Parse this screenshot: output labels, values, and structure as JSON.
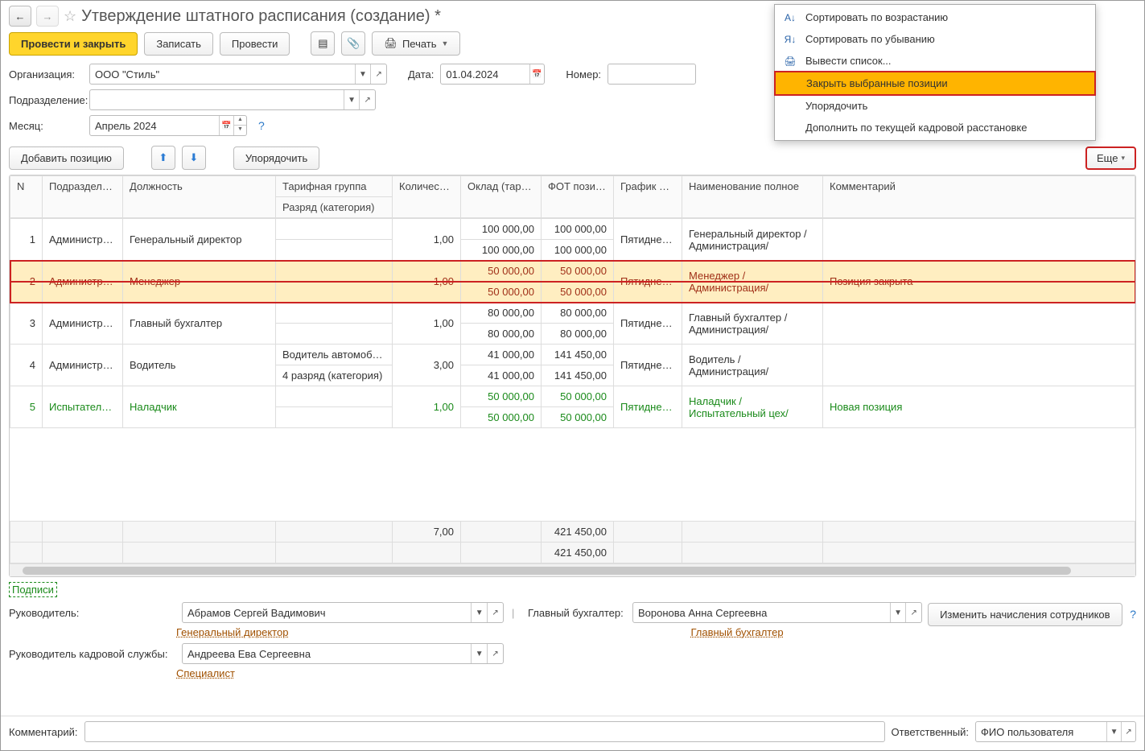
{
  "title": "Утверждение штатного расписания (создание) *",
  "toolbar": {
    "post_close": "Провести и закрыть",
    "save": "Записать",
    "post": "Провести",
    "print": "Печать"
  },
  "form": {
    "org_label": "Организация:",
    "org_value": "ООО \"Стиль\"",
    "dept_label": "Подразделение:",
    "dept_value": "",
    "month_label": "Месяц:",
    "month_value": "Апрель 2024",
    "date_label": "Дата:",
    "date_value": "01.04.2024",
    "number_label": "Номер:",
    "number_value": ""
  },
  "toolbar2": {
    "add_position": "Добавить позицию",
    "reorder": "Упорядочить",
    "more": "Еще"
  },
  "columns": {
    "n": "N",
    "dept": "Подразделение",
    "position": "Должность",
    "tariff_group": "Тарифная группа",
    "rank": "Разряд (категория)",
    "rates": "Количество ставок",
    "salary": "Оклад (тариф), ...",
    "fot": "ФОТ позиции, ...",
    "schedule": "График работы",
    "fullname": "Наименование полное",
    "comment": "Комментарий"
  },
  "rows": [
    {
      "n": "1",
      "dept": "Администраци",
      "pos": "Генеральный директор",
      "tg": "",
      "rank": "",
      "rates": "1,00",
      "salary": "100 000,00",
      "salary2": "100 000,00",
      "fot": "100 000,00",
      "fot2": "100 000,00",
      "sched": "Пятидневка",
      "full": "Генеральный директор /Администрация/",
      "comment": "",
      "cls": ""
    },
    {
      "n": "2",
      "dept": "Администраци",
      "pos": "Менеджер",
      "tg": "",
      "rank": "",
      "rates": "1,00",
      "salary": "50 000,00",
      "salary2": "50 000,00",
      "fot": "50 000,00",
      "fot2": "50 000,00",
      "sched": "Пятидневка",
      "full": "Менеджер /Администрация/",
      "comment": "Позиция закрыта",
      "cls": "row-closed"
    },
    {
      "n": "3",
      "dept": "Администраци",
      "pos": "Главный бухгалтер",
      "tg": "",
      "rank": "",
      "rates": "1,00",
      "salary": "80 000,00",
      "salary2": "80 000,00",
      "fot": "80 000,00",
      "fot2": "80 000,00",
      "sched": "Пятидневка",
      "full": "Главный бухгалтер /Администрация/",
      "comment": "",
      "cls": ""
    },
    {
      "n": "4",
      "dept": "Администраци",
      "pos": "Водитель",
      "tg": "Водитель автомоби...",
      "rank": "4 разряд (категория)",
      "rates": "3,00",
      "salary": "41 000,00",
      "salary2": "41 000,00",
      "fot": "141 450,00",
      "fot2": "141 450,00",
      "sched": "Пятидневка",
      "full": "Водитель /Администрация/",
      "comment": "",
      "cls": ""
    },
    {
      "n": "5",
      "dept": "Испытательны цех",
      "pos": "Наладчик",
      "tg": "",
      "rank": "",
      "rates": "1,00",
      "salary": "50 000,00",
      "salary2": "50 000,00",
      "fot": "50 000,00",
      "fot2": "50 000,00",
      "sched": "Пятидневка",
      "full": "Наладчик /Испытательный цех/",
      "comment": "Новая позиция",
      "cls": "row-new"
    }
  ],
  "totals": {
    "rates": "7,00",
    "fot1": "421 450,00",
    "fot2": "421 450,00"
  },
  "footer": {
    "signatures": "Подписи",
    "manager_label": "Руководитель:",
    "manager_value": "Абрамов Сергей Вадимович",
    "manager_role": "Генеральный директор",
    "accountant_label": "Главный бухгалтер:",
    "accountant_value": "Воронова Анна Сергеевна",
    "accountant_role": "Главный бухгалтер",
    "hr_label": "Руководитель кадровой службы:",
    "hr_value": "Андреева Ева Сергеевна",
    "hr_role": "Специалист",
    "change_accruals": "Изменить начисления сотрудников",
    "comment_label": "Комментарий:",
    "responsible_label": "Ответственный:",
    "responsible_value": "ФИО пользователя"
  },
  "menu": {
    "sort_asc": "Сортировать по возрастанию",
    "sort_desc": "Сортировать по убыванию",
    "output_list": "Вывести список...",
    "close_positions": "Закрыть выбранные позиции",
    "reorder": "Упорядочить",
    "fill_current": "Дополнить по текущей кадровой расстановке"
  }
}
